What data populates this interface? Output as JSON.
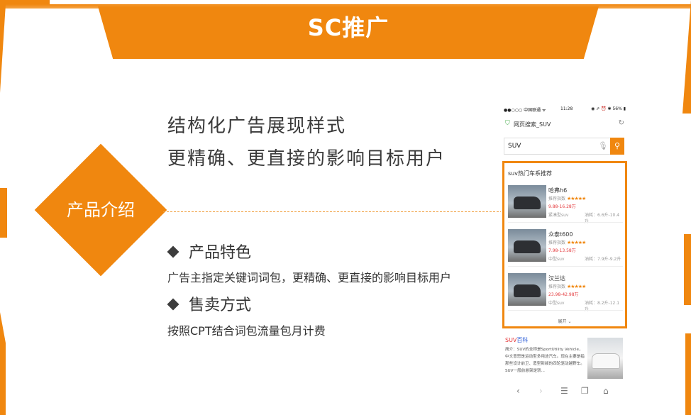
{
  "banner": {
    "title": "SC推广"
  },
  "headline": {
    "line1": "结构化广告展现样式",
    "line2": "更精确、更直接的影响目标用户"
  },
  "section_label": "产品介绍",
  "features": [
    {
      "title": "产品特色",
      "desc": "广告主指定关键词词包，更精确、更直接的影响目标用户"
    },
    {
      "title": "售卖方式",
      "desc": "按照CPT结合词包流量包月计费"
    }
  ],
  "phone": {
    "status": {
      "carrier": "●●○○○ 中国联通 ᯤ",
      "time": "11:28",
      "battery": "◉ ⇗ ⏰ ✱ 56% ▮"
    },
    "url": "网页搜索_SUV",
    "search_value": "SUV",
    "recommend_title": "suv热门车系推荐",
    "cars": [
      {
        "name": "哈弗h6",
        "rating_label": "推荐指数",
        "stars": "★★★★★",
        "price": "9.88-16.28万",
        "class": "紧凑型suv",
        "fuel": "油耗：6.6升-10.4升"
      },
      {
        "name": "众泰t600",
        "rating_label": "推荐指数",
        "stars": "★★★★★",
        "price": "7.98-13.58万",
        "class": "中型suv",
        "fuel": "油耗：7.9升-9.2升"
      },
      {
        "name": "汉兰达",
        "rating_label": "推荐指数",
        "stars": "★★★★★",
        "price": "23.98-42.98万",
        "class": "中型suv",
        "fuel": "油耗：8.2升-12.1升"
      }
    ],
    "expand_label": "展开 ⌄",
    "baike": {
      "title_prefix": "SUV",
      "title_suffix": "百科",
      "text": "简介：SUV的全称是SportUtility Vehicle，中文意思是运动型多用途汽车。现在主要是指那些设计前卫、造型新颖的四轮驱动越野车。SUV一般前悬架是轿..."
    },
    "nav": {
      "back": "‹",
      "forward": "›",
      "menu": "☰",
      "tabs": "❐",
      "home": "⌂"
    }
  },
  "colors": {
    "accent": "#f0870f",
    "price": "#e4393c",
    "link": "#2a5bd7"
  }
}
